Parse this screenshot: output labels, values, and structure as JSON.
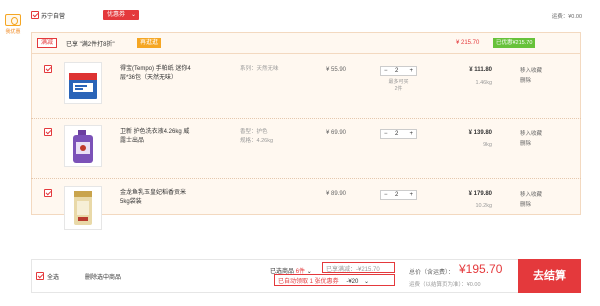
{
  "sidebar": {
    "coupon_label": "我优惠",
    "coupon_icon": "coupon-icon"
  },
  "store": {
    "name": "苏宁自营",
    "coupon_button": "优惠券",
    "coupon_chevron": "⌄",
    "shipping": "运费：¥0.00"
  },
  "promo": {
    "tag": "满减",
    "text": "已享 \"满2件打8折\"",
    "go": "再逛逛",
    "price": "¥ 215.70",
    "saved": "已优惠¥215.70"
  },
  "products": [
    {
      "name": "得宝(Tempo) 手帕纸 迷你4层*36包（天然无味）",
      "attrs": [
        "系列：天然无味"
      ],
      "price": "¥ 55.90",
      "qty": "2",
      "limit": [
        "最多可买",
        "2件"
      ],
      "subtotal": "¥ 111.80",
      "weight": "1.46kg",
      "actions": [
        "移入收藏",
        "删除"
      ]
    },
    {
      "name": "卫新 护色洗衣液4.26kg 威露士出品",
      "attrs": [
        "香型：护色",
        "规格：4.26kg"
      ],
      "price": "¥ 69.90",
      "qty": "2",
      "limit": [],
      "subtotal": "¥ 139.80",
      "weight": "9kg",
      "actions": [
        "移入收藏",
        "删除"
      ]
    },
    {
      "name": "金龙鱼乳玉皇妃稻香贡米 5kg袋装",
      "attrs": [],
      "price": "¥ 89.90",
      "qty": "2",
      "limit": [],
      "subtotal": "¥ 179.80",
      "weight": "10.2kg",
      "actions": [
        "移入收藏",
        "删除"
      ]
    }
  ],
  "stepper": {
    "minus": "−",
    "plus": "+"
  },
  "footer": {
    "select_all": "全选",
    "delete_selected": "删除选中商品",
    "selected_prefix": "已选商品",
    "selected_count": "6件",
    "selected_chevron": "⌄",
    "discount_label": "已享满减：-¥215.70",
    "auto_claim": "已自动领取 1 张优惠券",
    "auto_claim_value": "-¥20",
    "auto_chevron": "⌄",
    "total_label": "总价（含运费）：",
    "total": "¥195.70",
    "total_sub": "运费（以结算页为准）：¥0.00",
    "checkout": "去结算"
  },
  "colors": {
    "accent": "#e4393c",
    "orange": "#f5a623",
    "green": "#67c23a"
  }
}
